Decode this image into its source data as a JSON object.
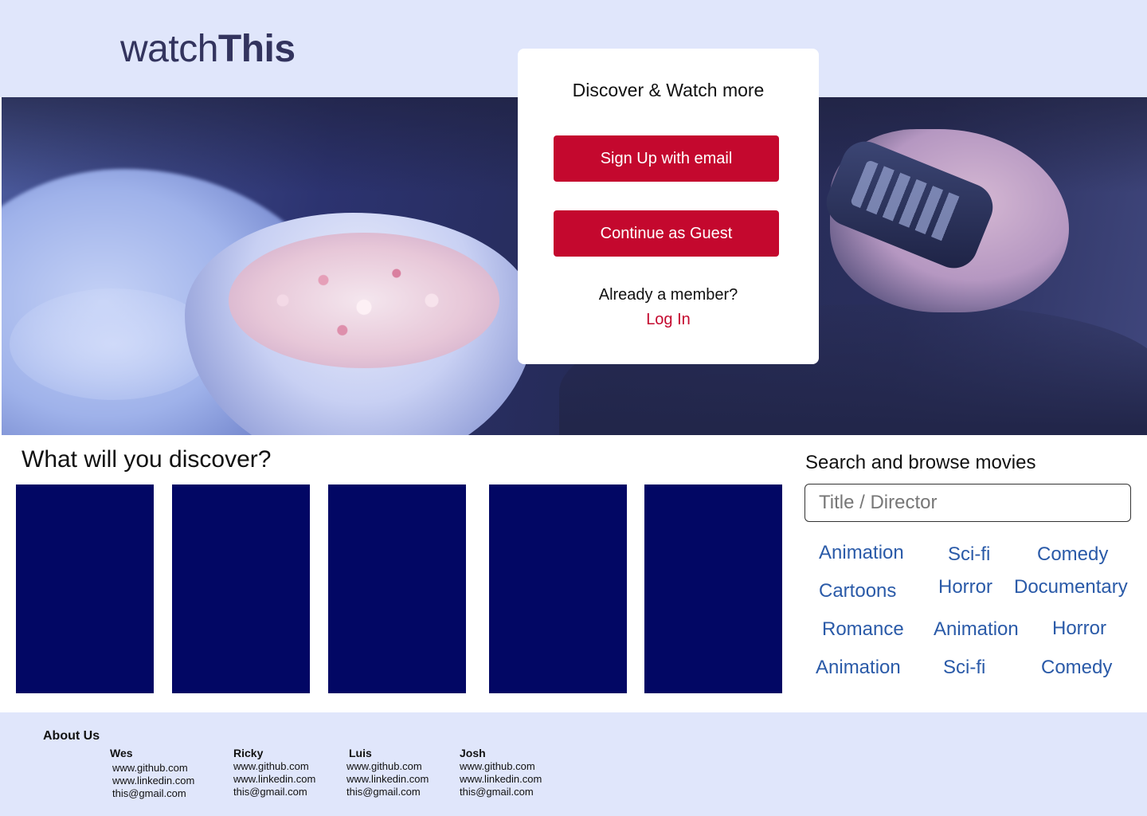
{
  "brand": {
    "name_regular": "watch",
    "name_bold": "This"
  },
  "auth": {
    "title": "Discover & Watch more",
    "signup_label": "Sign Up with email",
    "guest_label": "Continue as Guest",
    "member_prompt": "Already a member?",
    "login_label": "Log In"
  },
  "discover": {
    "title": "What will you discover?"
  },
  "search": {
    "title": "Search and browse movies",
    "placeholder": "Title / Director",
    "genres": [
      "Animation",
      "Sci-fi",
      "Comedy",
      "Cartoons",
      "Horror",
      "Documentary",
      "Romance",
      "Animation",
      "Horror",
      "Animation",
      "Sci-fi",
      "Comedy"
    ]
  },
  "footer": {
    "about_title": "About Us",
    "members": [
      {
        "name": "Wes",
        "github": "www.github.com",
        "linkedin": "www.linkedin.com",
        "email": "this@gmail.com"
      },
      {
        "name": "Ricky",
        "github": "www.github.com",
        "linkedin": "www.linkedin.com",
        "email": "this@gmail.com"
      },
      {
        "name": "Luis",
        "github": "www.github.com",
        "linkedin": "www.linkedin.com",
        "email": "this@gmail.com"
      },
      {
        "name": "Josh",
        "github": "www.github.com",
        "linkedin": "www.linkedin.com",
        "email": "this@gmail.com"
      }
    ]
  },
  "colors": {
    "header_bg": "#e0e6fb",
    "accent_red": "#c4082e",
    "card_navy": "#020764",
    "genre_blue": "#2a5aa8",
    "logo": "#33345e"
  }
}
